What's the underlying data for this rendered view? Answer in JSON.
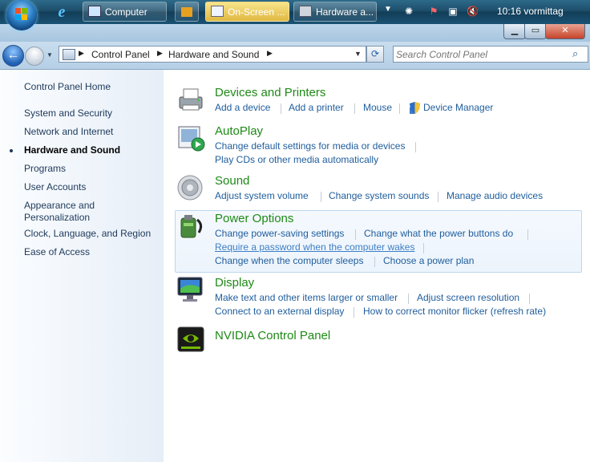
{
  "taskbar": {
    "buttons": [
      {
        "label": "Computer"
      },
      {
        "label": ""
      },
      {
        "label": "On-Screen ..."
      },
      {
        "label": "Hardware a..."
      }
    ],
    "clock": "10:16 vormittag"
  },
  "window": {
    "address_crumbs": [
      "Control Panel",
      "Hardware and Sound"
    ],
    "search_placeholder": "Search Control Panel"
  },
  "sidebar": {
    "home": "Control Panel Home",
    "items": [
      {
        "label": "System and Security"
      },
      {
        "label": "Network and Internet"
      },
      {
        "label": "Hardware and Sound"
      },
      {
        "label": "Programs"
      },
      {
        "label": "User Accounts"
      },
      {
        "label": "Appearance and Personalization"
      },
      {
        "label": "Clock, Language, and Region"
      },
      {
        "label": "Ease of Access"
      }
    ]
  },
  "categories": [
    {
      "title": "Devices and Printers",
      "icon": "printer-icon",
      "links": [
        "Add a device",
        "Add a printer",
        "Mouse",
        "Device Manager"
      ]
    },
    {
      "title": "AutoPlay",
      "icon": "autoplay-icon",
      "links": [
        "Change default settings for media or devices",
        "Play CDs or other media automatically"
      ]
    },
    {
      "title": "Sound",
      "icon": "speaker-icon",
      "links": [
        "Adjust system volume",
        "Change system sounds",
        "Manage audio devices"
      ]
    },
    {
      "title": "Power Options",
      "icon": "power-icon",
      "links": [
        "Change power-saving settings",
        "Change what the power buttons do",
        "Require a password when the computer wakes",
        "Change when the computer sleeps",
        "Choose a power plan"
      ]
    },
    {
      "title": "Display",
      "icon": "monitor-icon",
      "links": [
        "Make text and other items larger or smaller",
        "Adjust screen resolution",
        "Connect to an external display",
        "How to correct monitor flicker (refresh rate)"
      ]
    },
    {
      "title": "NVIDIA Control Panel",
      "icon": "nvidia-icon",
      "links": []
    }
  ]
}
